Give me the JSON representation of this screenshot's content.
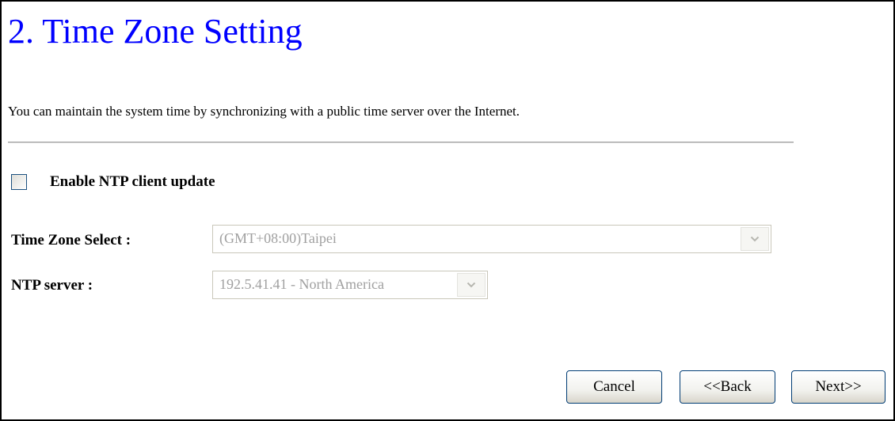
{
  "page": {
    "title": "2. Time Zone Setting",
    "description": "You can maintain the system time by synchronizing with a public time server over the Internet."
  },
  "ntp": {
    "checkbox_label": "Enable NTP client update",
    "checked": false
  },
  "timezone": {
    "label": "Time Zone Select :",
    "value": "(GMT+08:00)Taipei",
    "disabled": true
  },
  "ntp_server": {
    "label": "NTP server :",
    "value": "192.5.41.41 - North America",
    "disabled": true
  },
  "buttons": {
    "cancel": "Cancel",
    "back": "<<Back",
    "next": "Next>>"
  },
  "colors": {
    "title": "#0000ff",
    "disabled_text": "#a0a0a0",
    "button_border": "#003c74"
  },
  "icons": {
    "dropdown_arrow": "chevron-down-icon"
  }
}
